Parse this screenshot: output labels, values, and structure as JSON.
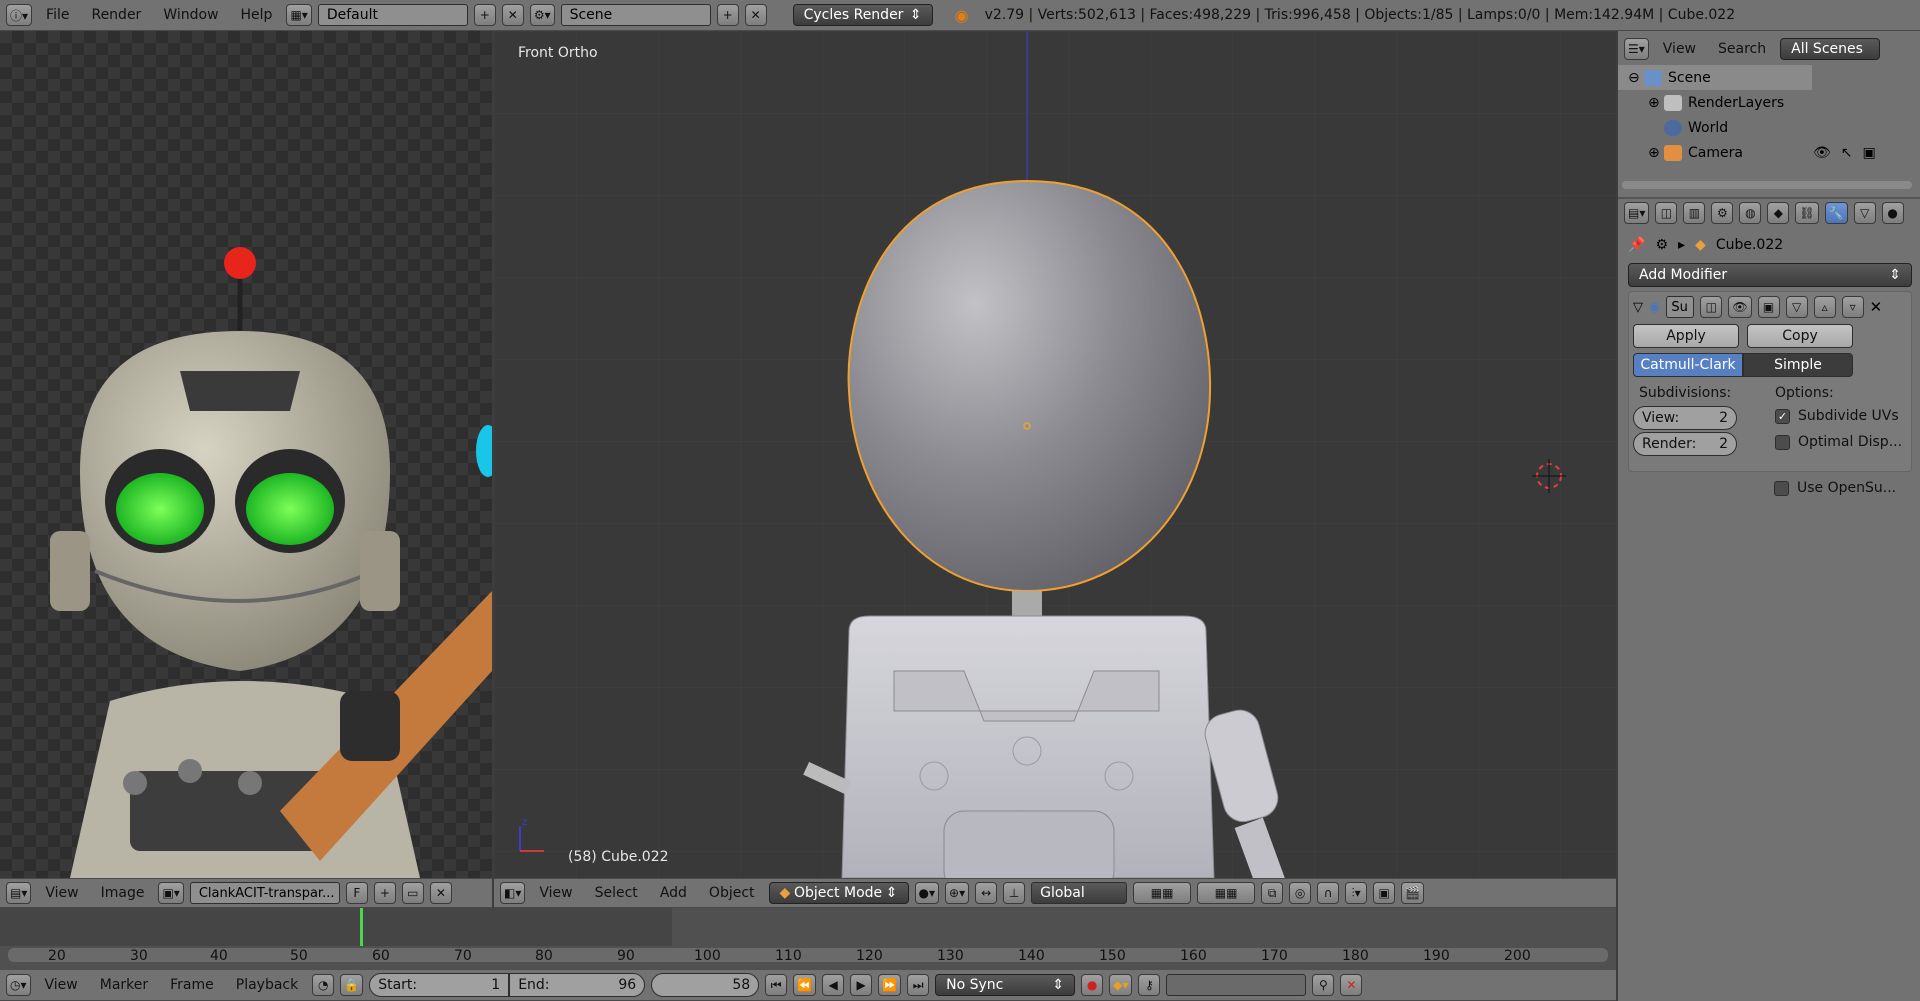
{
  "topbar": {
    "menus": [
      "File",
      "Render",
      "Window",
      "Help"
    ],
    "layout": "Default",
    "scene": "Scene",
    "engine": "Cycles Render",
    "status": "v2.79 | Verts:502,613 | Faces:498,229 | Tris:996,458 | Objects:1/85 | Lamps:0/0 | Mem:142.94M | Cube.022"
  },
  "image_editor": {
    "menus": [
      "View",
      "Image"
    ],
    "image_name": "ClankACIT-transpar...",
    "f_label": "F"
  },
  "viewport": {
    "view_label": "Front Ortho",
    "object_label": "(58) Cube.022",
    "menus": [
      "View",
      "Select",
      "Add",
      "Object"
    ],
    "mode": "Object Mode",
    "orientation": "Global"
  },
  "outliner": {
    "menus": [
      "View",
      "Search"
    ],
    "filter": "All Scenes",
    "items": [
      "Scene",
      "RenderLayers",
      "World",
      "Camera"
    ]
  },
  "properties": {
    "object_name": "Cube.022",
    "add_modifier": "Add Modifier",
    "modifier_name": "Su",
    "apply": "Apply",
    "copy": "Copy",
    "tab_catmull": "Catmull-Clark",
    "tab_simple": "Simple",
    "subdivisions_label": "Subdivisions:",
    "options_label": "Options:",
    "view_label": "View:",
    "view_value": "2",
    "render_label": "Render:",
    "render_value": "2",
    "opt1": "Subdivide UVs",
    "opt2": "Optimal Disp...",
    "opt3": "Use OpenSu..."
  },
  "timeline": {
    "ticks": [
      "20",
      "30",
      "40",
      "50",
      "60",
      "70",
      "80",
      "90",
      "100",
      "110",
      "120",
      "130",
      "140",
      "150",
      "160",
      "170",
      "180",
      "190",
      "200"
    ],
    "menus": [
      "View",
      "Marker",
      "Frame",
      "Playback"
    ],
    "start_label": "Start:",
    "start_value": "1",
    "end_label": "End:",
    "end_value": "96",
    "current": "58",
    "sync": "No Sync"
  },
  "colors": {
    "accent": "#5680c2",
    "selection": "#f0a030",
    "viewport_bg": "#393939"
  }
}
